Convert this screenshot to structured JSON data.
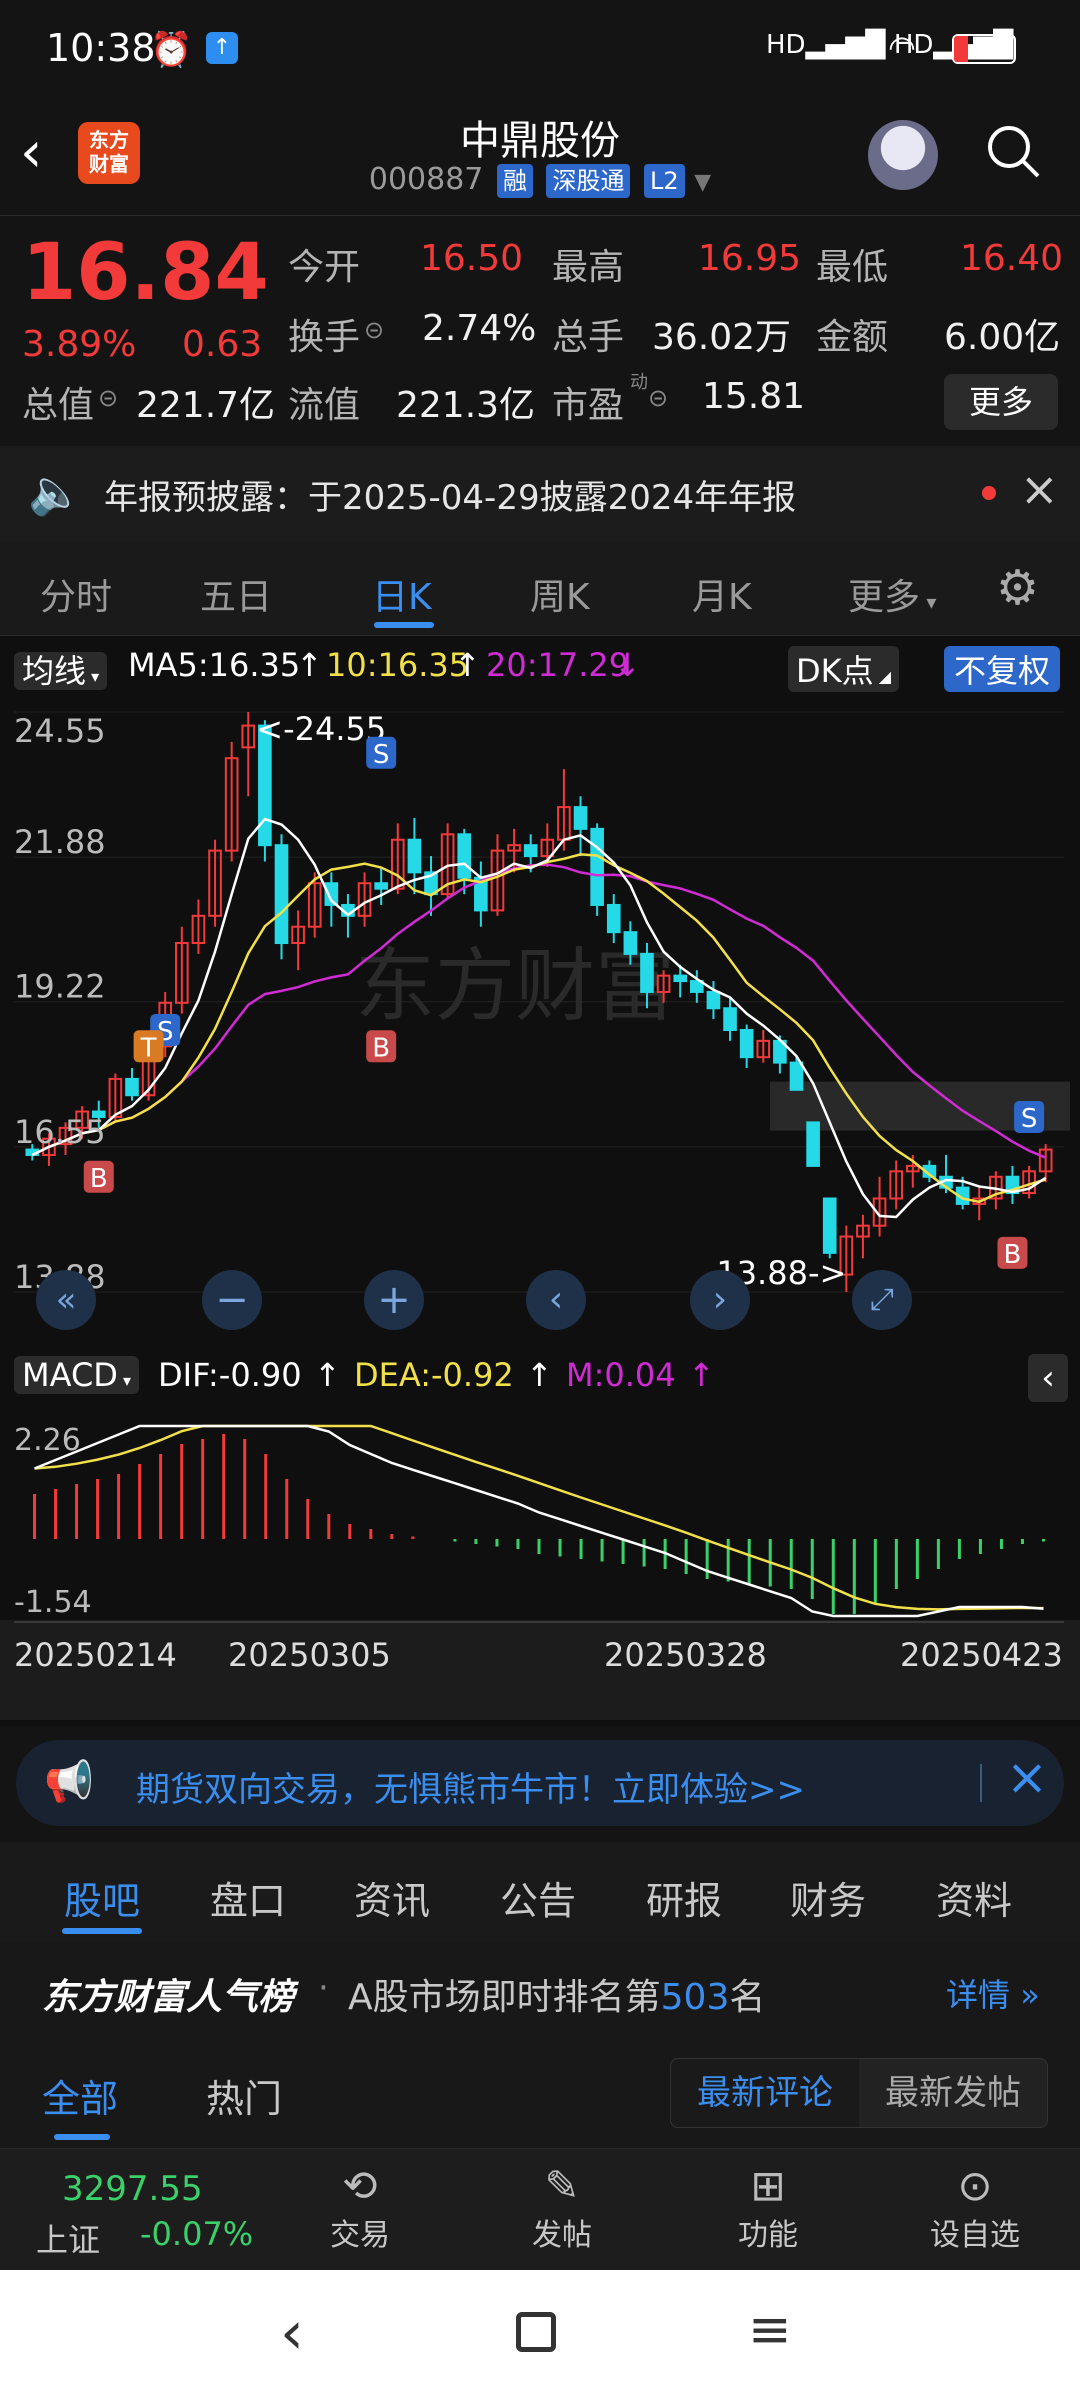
{
  "status": {
    "time": "10:38",
    "battery": "18"
  },
  "header": {
    "logo_text": "东方财富",
    "title": "中鼎股份",
    "code": "000887",
    "tags": [
      "融",
      "深股通",
      "L2"
    ]
  },
  "quote": {
    "price": "16.84",
    "pct": "3.89%",
    "change": "0.63",
    "open_label": "今开",
    "open": "16.50",
    "high_label": "最高",
    "high": "16.95",
    "low_label": "最低",
    "low": "16.40",
    "turnover_label": "换手",
    "turnover": "2.74%",
    "volume_label": "总手",
    "volume": "36.02万",
    "amount_label": "金额",
    "amount": "6.00亿",
    "mktcap_label": "总值",
    "mktcap": "221.7亿",
    "float_label": "流值",
    "float": "221.3亿",
    "pe_label": "市盈",
    "pe_sup": "动",
    "pe": "15.81",
    "more": "更多"
  },
  "notice": {
    "text": "年报预披露：于2025-04-29披露2024年年报"
  },
  "tabs": [
    "分时",
    "五日",
    "日K",
    "周K",
    "月K",
    "更多"
  ],
  "active_tab": 2,
  "indicators": {
    "ma_type": "均线",
    "ma5": "MA5:16.35",
    "ma10": "10:16.35",
    "ma20": "20:17.29",
    "dk": "DK点",
    "fq": "不复权",
    "macd_type": "MACD",
    "dif": "DIF:-0.90",
    "dea": "DEA:-0.92",
    "m": "M:0.04"
  },
  "colors": {
    "up": "#f23a3a",
    "down": "#26d9e6",
    "ma5": "#ffffff",
    "ma10": "#f2e04a",
    "ma20": "#d02bd4",
    "accent": "#3a8ef0"
  },
  "chart_data": {
    "type": "candlestick",
    "y_ticks": [
      "24.55",
      "21.88",
      "19.22",
      "16.55",
      "13.88"
    ],
    "ylim": [
      13.88,
      24.55
    ],
    "max_label": "24.55",
    "min_label": "13.88->",
    "macd_ticks": [
      "2.26",
      "-1.54"
    ],
    "x_labels": [
      "20250214",
      "20250305",
      "20250328",
      "20250423"
    ],
    "candles": [
      [
        16.5,
        16.6,
        16.3,
        16.4
      ],
      [
        16.4,
        16.8,
        16.2,
        16.7
      ],
      [
        16.6,
        17.0,
        16.4,
        16.9
      ],
      [
        16.9,
        17.3,
        16.7,
        17.2
      ],
      [
        17.2,
        17.4,
        16.9,
        17.1
      ],
      [
        17.1,
        17.9,
        17.0,
        17.8
      ],
      [
        17.8,
        18.0,
        17.4,
        17.5
      ],
      [
        17.5,
        18.6,
        17.4,
        18.4
      ],
      [
        18.4,
        19.4,
        18.2,
        19.2
      ],
      [
        19.2,
        20.6,
        19.0,
        20.3
      ],
      [
        20.3,
        21.1,
        20.1,
        20.8
      ],
      [
        20.8,
        22.2,
        20.6,
        22.0
      ],
      [
        22.0,
        24.0,
        21.8,
        23.7
      ],
      [
        23.9,
        24.55,
        23.0,
        24.3
      ],
      [
        24.3,
        24.4,
        21.8,
        22.1
      ],
      [
        22.1,
        22.3,
        20.0,
        20.3
      ],
      [
        20.3,
        20.9,
        19.8,
        20.6
      ],
      [
        20.6,
        21.6,
        20.4,
        21.4
      ],
      [
        21.4,
        21.6,
        20.6,
        21.0
      ],
      [
        21.0,
        21.2,
        20.4,
        20.8
      ],
      [
        20.8,
        21.6,
        20.6,
        21.4
      ],
      [
        21.4,
        21.7,
        21.0,
        21.3
      ],
      [
        21.3,
        22.5,
        21.2,
        22.2
      ],
      [
        22.2,
        22.6,
        21.2,
        21.6
      ],
      [
        21.6,
        21.9,
        20.8,
        21.2
      ],
      [
        21.2,
        22.5,
        21.1,
        22.3
      ],
      [
        22.3,
        22.4,
        21.2,
        21.5
      ],
      [
        21.5,
        21.8,
        20.6,
        20.9
      ],
      [
        20.9,
        22.3,
        20.8,
        22.0
      ],
      [
        22.0,
        22.4,
        21.6,
        22.1
      ],
      [
        22.1,
        22.3,
        21.6,
        21.9
      ],
      [
        21.9,
        22.5,
        21.7,
        22.2
      ],
      [
        22.2,
        23.5,
        22.0,
        22.8
      ],
      [
        22.8,
        23.0,
        21.9,
        22.4
      ],
      [
        22.4,
        22.5,
        20.8,
        21.0
      ],
      [
        21.0,
        21.2,
        20.3,
        20.5
      ],
      [
        20.5,
        20.7,
        19.9,
        20.1
      ],
      [
        20.1,
        20.3,
        19.1,
        19.4
      ],
      [
        19.4,
        19.8,
        19.2,
        19.7
      ],
      [
        19.7,
        19.9,
        19.3,
        19.6
      ],
      [
        19.6,
        19.8,
        19.2,
        19.4
      ],
      [
        19.4,
        19.6,
        18.9,
        19.1
      ],
      [
        19.1,
        19.3,
        18.5,
        18.7
      ],
      [
        18.7,
        18.8,
        18.0,
        18.2
      ],
      [
        18.2,
        18.7,
        18.1,
        18.5
      ],
      [
        18.5,
        18.6,
        17.9,
        18.1
      ],
      [
        18.1,
        18.2,
        17.6,
        17.6
      ],
      [
        17.0,
        17.0,
        16.2,
        16.2
      ],
      [
        15.6,
        15.6,
        14.5,
        14.6
      ],
      [
        14.2,
        15.1,
        13.88,
        14.9
      ],
      [
        14.9,
        15.3,
        14.5,
        15.1
      ],
      [
        15.1,
        16.0,
        14.9,
        15.6
      ],
      [
        15.6,
        16.3,
        15.4,
        16.1
      ],
      [
        16.1,
        16.4,
        15.8,
        16.2
      ],
      [
        16.2,
        16.3,
        15.9,
        16.0
      ],
      [
        16.0,
        16.4,
        15.7,
        15.8
      ],
      [
        15.8,
        16.0,
        15.4,
        15.5
      ],
      [
        15.5,
        15.8,
        15.2,
        15.6
      ],
      [
        15.6,
        16.1,
        15.4,
        16.0
      ],
      [
        16.0,
        16.2,
        15.5,
        15.7
      ],
      [
        15.7,
        16.2,
        15.6,
        16.1
      ],
      [
        16.1,
        16.6,
        15.9,
        16.5
      ]
    ],
    "macd_hist": [
      0.9,
      1.0,
      1.1,
      1.2,
      1.3,
      1.5,
      1.7,
      1.9,
      2.0,
      2.1,
      2.0,
      1.7,
      1.2,
      0.8,
      0.5,
      0.3,
      0.2,
      0.1,
      0.05,
      0.0,
      -0.05,
      -0.1,
      -0.15,
      -0.2,
      -0.3,
      -0.35,
      -0.4,
      -0.45,
      -0.5,
      -0.55,
      -0.6,
      -0.7,
      -0.8,
      -0.85,
      -0.9,
      -0.95,
      -1.0,
      -1.2,
      -1.5,
      -1.5,
      -1.3,
      -1.0,
      -0.8,
      -0.6,
      -0.4,
      -0.3,
      -0.2,
      -0.1,
      -0.05
    ],
    "buy_sell_markers": [
      "S",
      "T",
      "S",
      "B",
      "B",
      "S",
      "B",
      "S"
    ]
  },
  "banner": {
    "text": "期货双向交易，无惧熊市牛市！立即体验>>"
  },
  "subtabs": [
    "股吧",
    "盘口",
    "资讯",
    "公告",
    "研报",
    "财务",
    "资料"
  ],
  "rank": {
    "brand": "东方财富人气榜",
    "dot": "·",
    "text_prefix": "A股市场即时排名第",
    "rank": "503",
    "text_suffix": "名",
    "detail": "详情"
  },
  "filter": {
    "all": "全部",
    "hot": "热门",
    "latest_comment": "最新评论",
    "latest_post": "最新发帖"
  },
  "bottom": {
    "index_name": "上证",
    "index_value": "3297.55",
    "index_pct": "-0.07%",
    "trade": "交易",
    "post": "发帖",
    "func": "功能",
    "watch": "设自选"
  }
}
